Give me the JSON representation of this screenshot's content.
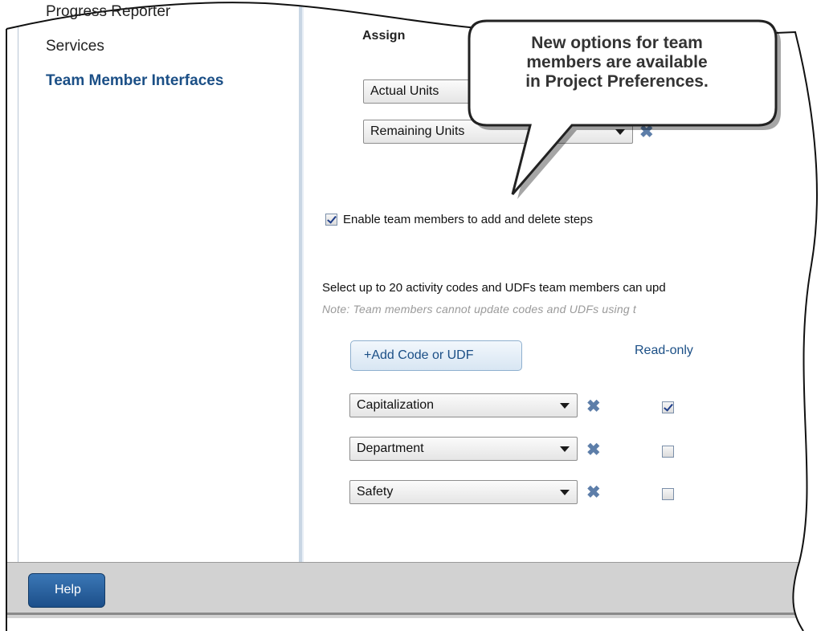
{
  "sidebar": {
    "items": [
      {
        "label": "Progress Reporter"
      },
      {
        "label": "Services"
      },
      {
        "label": "Team Member Interfaces"
      }
    ]
  },
  "assignments": {
    "heading": "Assign",
    "fields": [
      "Actual Units",
      "Remaining Units"
    ]
  },
  "steps": {
    "checkbox_label": "Enable team members to add and delete steps",
    "checked": true
  },
  "codes": {
    "instruction": "Select up to 20 activity codes and UDFs team members can upd",
    "note": "Note: Team members cannot update codes and UDFs using t",
    "add_button": "+Add Code or UDF",
    "readonly_header": "Read-only",
    "rows": [
      {
        "name": "Capitalization",
        "read_only": true
      },
      {
        "name": "Department",
        "read_only": false
      },
      {
        "name": "Safety",
        "read_only": false
      }
    ]
  },
  "footer": {
    "help_label": "Help"
  },
  "callout": {
    "line1": "New options for team",
    "line2": "members are available",
    "line3": "in Project Preferences."
  },
  "colors": {
    "accent": "#1b4f86",
    "panel_bg": "#d2d2d2",
    "remove_icon": "#5d7ea9"
  }
}
